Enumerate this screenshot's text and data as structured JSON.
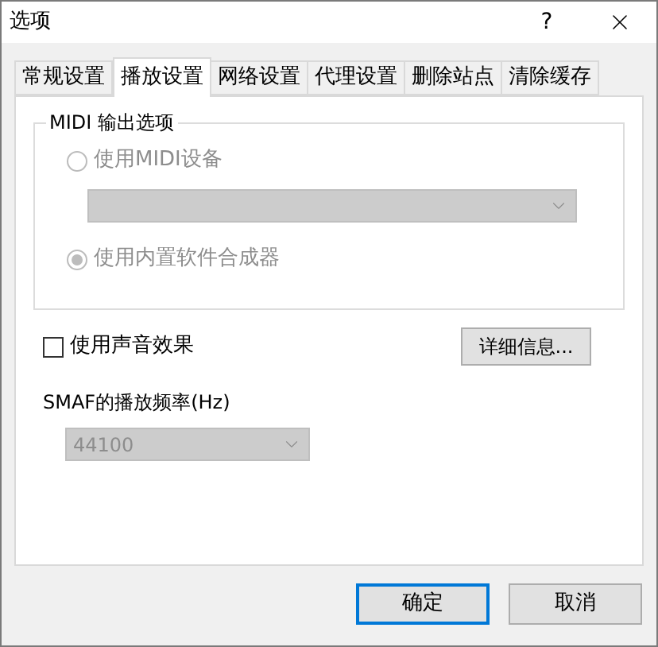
{
  "window": {
    "title": "选项",
    "help": "?"
  },
  "tabs": [
    {
      "label": "常规设置",
      "selected": false
    },
    {
      "label": "播放设置",
      "selected": true
    },
    {
      "label": "网络设置",
      "selected": false
    },
    {
      "label": "代理设置",
      "selected": false
    },
    {
      "label": "删除站点",
      "selected": false
    },
    {
      "label": "清除缓存",
      "selected": false
    }
  ],
  "midi_group": {
    "title": "MIDI 输出选项",
    "disabled": true,
    "options": [
      {
        "label": "使用MIDI设备",
        "selected": false
      },
      {
        "label": "使用内置软件合成器",
        "selected": true
      }
    ]
  },
  "sound_effect": {
    "label": "使用声音效果",
    "checked": false
  },
  "details_button": "详细信息...",
  "smaf_rate": {
    "label": "SMAF的播放频率(Hz)",
    "value": "44100",
    "disabled": true
  },
  "buttons": [
    {
      "label": "确定",
      "default": true
    },
    {
      "label": "取消",
      "default": false
    }
  ]
}
